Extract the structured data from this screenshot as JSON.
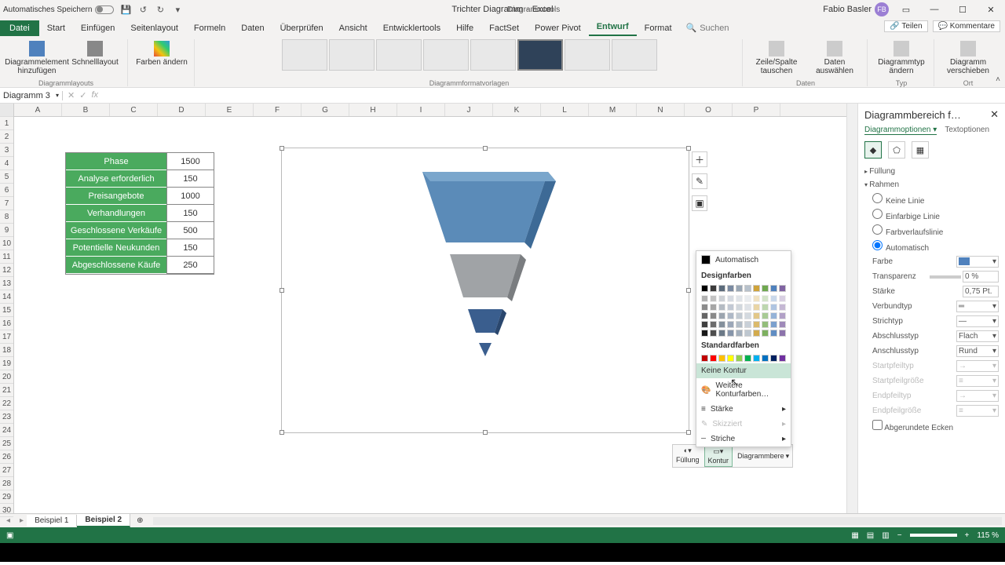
{
  "titlebar": {
    "autosave": "Automatisches Speichern",
    "doc_title": "Trichter Diagramm",
    "app_name": "Excel",
    "tool_context": "Diagrammtools",
    "user": "Fabio Basler",
    "user_initials": "FB"
  },
  "ribbon": {
    "tabs": [
      "Datei",
      "Start",
      "Einfügen",
      "Seitenlayout",
      "Formeln",
      "Daten",
      "Überprüfen",
      "Ansicht",
      "Entwicklertools",
      "Hilfe",
      "FactSet",
      "Power Pivot",
      "Entwurf",
      "Format"
    ],
    "search_placeholder": "Suchen",
    "share": "Teilen",
    "comments": "Kommentare",
    "groups": {
      "layouts": "Diagrammlayouts",
      "add_element": "Diagrammelement hinzufügen",
      "quick_layout": "Schnelllayout",
      "colors": "Farben ändern",
      "styles": "Diagrammformatvorlagen",
      "switch_rc": "Zeile/Spalte tauschen",
      "select_data": "Daten auswählen",
      "data": "Daten",
      "change_type": "Diagrammtyp ändern",
      "type": "Typ",
      "move_chart": "Diagramm verschieben",
      "location": "Ort"
    }
  },
  "namebox": "Diagramm 3",
  "columns": [
    "A",
    "B",
    "C",
    "D",
    "E",
    "F",
    "G",
    "H",
    "I",
    "J",
    "K",
    "L",
    "M",
    "N",
    "O",
    "P"
  ],
  "table": {
    "rows": [
      {
        "label": "Phase",
        "value": "1500"
      },
      {
        "label": "Analyse erforderlich",
        "value": "150"
      },
      {
        "label": "Preisangebote",
        "value": "1000"
      },
      {
        "label": "Verhandlungen",
        "value": "150"
      },
      {
        "label": "Geschlossene Verkäufe",
        "value": "500"
      },
      {
        "label": "Potentielle Neukunden",
        "value": "150"
      },
      {
        "label": "Abgeschlossene Käufe",
        "value": "250"
      }
    ]
  },
  "chart_data": {
    "type": "bar",
    "chart_style": "funnel",
    "categories": [
      "Phase",
      "Analyse erforderlich",
      "Preisangebote",
      "Verhandlungen",
      "Geschlossene Verkäufe",
      "Potentielle Neukunden",
      "Abgeschlossene Käufe"
    ],
    "values": [
      1500,
      150,
      1000,
      150,
      500,
      150,
      250
    ],
    "title": "",
    "xlabel": "",
    "ylabel": ""
  },
  "color_popup": {
    "automatic": "Automatisch",
    "design_colors": "Designfarben",
    "standard_colors": "Standardfarben",
    "no_outline": "Keine Kontur",
    "more_outline": "Weitere Konturfarben…",
    "weight": "Stärke",
    "sketched": "Skizziert",
    "dashes": "Striche",
    "theme_swatches": [
      "#000000",
      "#3b3b3b",
      "#5b6b7b",
      "#7a8aa1",
      "#9aa7b5",
      "#b7c1cb",
      "#cfa33a",
      "#6fa84f",
      "#4f81bd",
      "#8064a2"
    ],
    "std_swatches": [
      "#c00000",
      "#ff0000",
      "#ffc000",
      "#ffff00",
      "#92d050",
      "#00b050",
      "#00b0f0",
      "#0070c0",
      "#002060",
      "#7030a0"
    ]
  },
  "mini_toolbar": {
    "fill": "Füllung",
    "outline": "Kontur",
    "area": "Diagrammbere"
  },
  "format_pane": {
    "title": "Diagrammbereich f…",
    "subtabs": {
      "chart": "Diagrammoptionen",
      "text": "Textoptionen"
    },
    "sections": {
      "fill": "Füllung",
      "border": "Rahmen"
    },
    "border_opts": {
      "none": "Keine Linie",
      "solid": "Einfarbige Linie",
      "gradient": "Farbverlaufslinie",
      "auto": "Automatisch"
    },
    "props": {
      "color": "Farbe",
      "transparency": "Transparenz",
      "transparency_val": "0 %",
      "width": "Stärke",
      "width_val": "0,75 Pt.",
      "compound": "Verbundtyp",
      "dash": "Strichtyp",
      "cap": "Abschlusstyp",
      "cap_val": "Flach",
      "join": "Anschlusstyp",
      "join_val": "Rund",
      "begin_arrow": "Startpfeiltyp",
      "begin_size": "Startpfeilgröße",
      "end_arrow": "Endpfeiltyp",
      "end_size": "Endpfeilgröße",
      "rounded": "Abgerundete Ecken"
    }
  },
  "sheet_tabs": [
    "Beispiel 1",
    "Beispiel 2"
  ],
  "statusbar": {
    "zoom": "115 %"
  }
}
